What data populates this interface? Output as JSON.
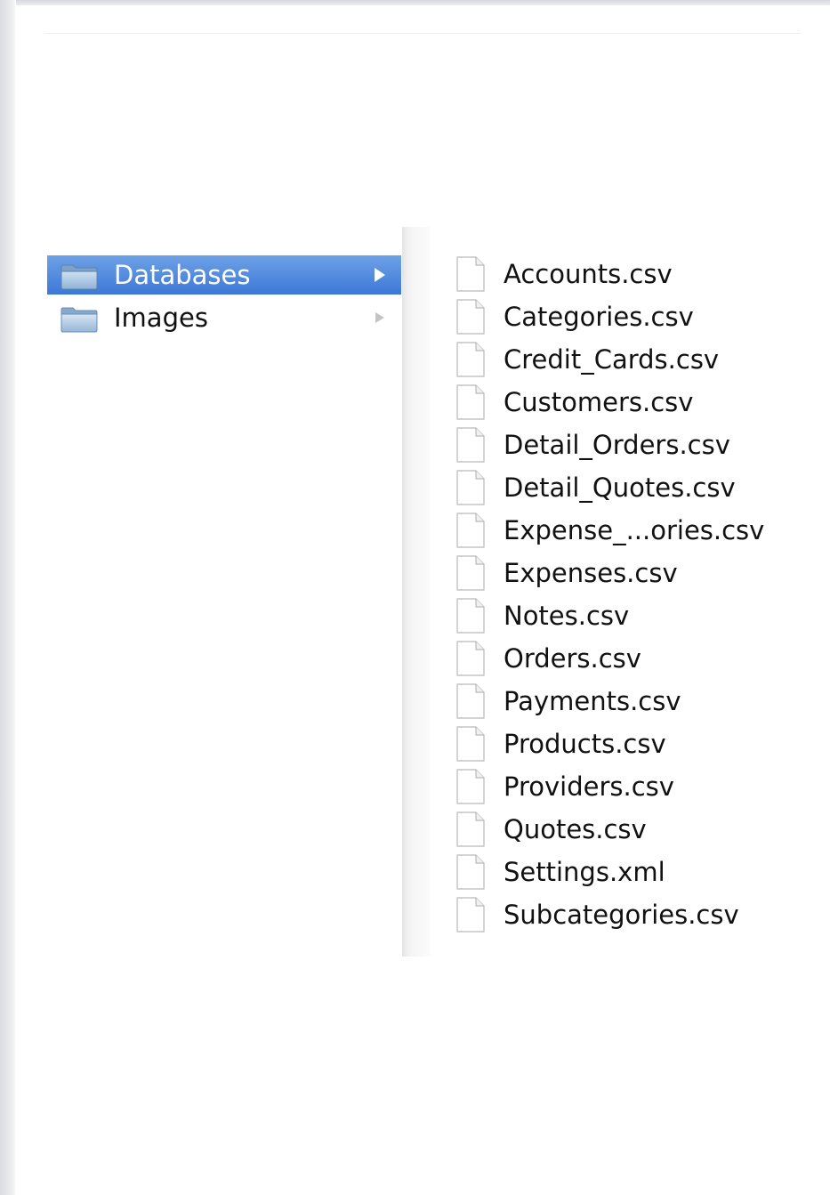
{
  "colors": {
    "selection": "#3c78d8",
    "selected_text": "#ffffff",
    "text": "#111111"
  },
  "folders": [
    {
      "label": "Databases",
      "selected": true,
      "icon": "folder-icon"
    },
    {
      "label": "Images",
      "selected": false,
      "icon": "folder-icon"
    }
  ],
  "files": [
    {
      "label": "Accounts.csv",
      "icon": "document-icon"
    },
    {
      "label": "Categories.csv",
      "icon": "document-icon"
    },
    {
      "label": "Credit_Cards.csv",
      "icon": "document-icon"
    },
    {
      "label": "Customers.csv",
      "icon": "document-icon"
    },
    {
      "label": "Detail_Orders.csv",
      "icon": "document-icon"
    },
    {
      "label": "Detail_Quotes.csv",
      "icon": "document-icon"
    },
    {
      "label": "Expense_...ories.csv",
      "icon": "document-icon"
    },
    {
      "label": "Expenses.csv",
      "icon": "document-icon"
    },
    {
      "label": "Notes.csv",
      "icon": "document-icon"
    },
    {
      "label": "Orders.csv",
      "icon": "document-icon"
    },
    {
      "label": "Payments.csv",
      "icon": "document-icon"
    },
    {
      "label": "Products.csv",
      "icon": "document-icon"
    },
    {
      "label": "Providers.csv",
      "icon": "document-icon"
    },
    {
      "label": "Quotes.csv",
      "icon": "document-icon"
    },
    {
      "label": "Settings.xml",
      "icon": "document-icon"
    },
    {
      "label": "Subcategories.csv",
      "icon": "document-icon"
    }
  ]
}
